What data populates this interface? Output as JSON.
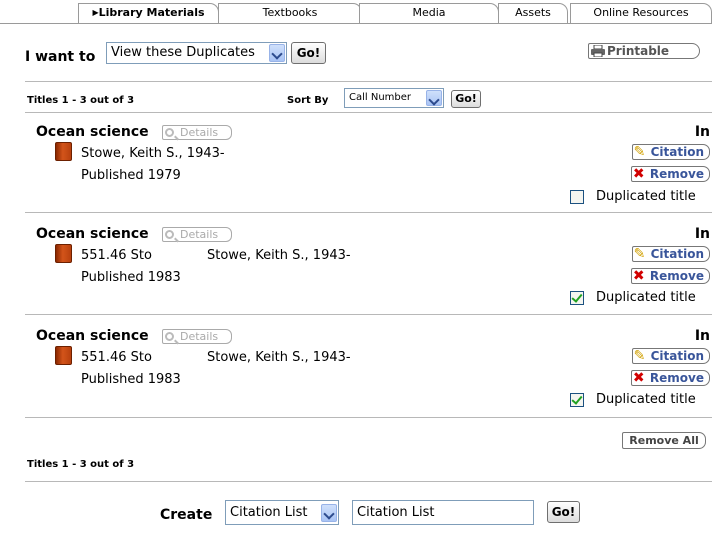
{
  "tabs": [
    {
      "label": "Library Materials",
      "active": true
    },
    {
      "label": "Textbooks",
      "active": false
    },
    {
      "label": "Media",
      "active": false
    },
    {
      "label": "Assets",
      "active": false
    },
    {
      "label": "Online Resources",
      "active": false
    }
  ],
  "action_bar": {
    "label": "I want to",
    "select_value": "View these Duplicates",
    "go_label": "Go!",
    "printable_label": "Printable"
  },
  "results_header": {
    "count_text": "Titles 1 - 3 out of 3",
    "sort_label": "Sort By",
    "sort_value": "Call Number",
    "go_label": "Go!"
  },
  "records": [
    {
      "title": "Ocean science",
      "details_label": "Details",
      "call_number": "",
      "author": "Stowe, Keith S., 1943-",
      "published": "Published 1979",
      "status": "In",
      "citation_label": "Citation",
      "remove_label": "Remove",
      "duplicated_checked": false,
      "duplicated_label": "Duplicated title"
    },
    {
      "title": "Ocean science",
      "details_label": "Details",
      "call_number": "551.46 Sto",
      "author": "Stowe, Keith S., 1943-",
      "published": "Published 1983",
      "status": "In",
      "citation_label": "Citation",
      "remove_label": "Remove",
      "duplicated_checked": true,
      "duplicated_label": "Duplicated title"
    },
    {
      "title": "Ocean science",
      "details_label": "Details",
      "call_number": "551.46 Sto",
      "author": "Stowe, Keith S., 1943-",
      "published": "Published 1983",
      "status": "In",
      "citation_label": "Citation",
      "remove_label": "Remove",
      "duplicated_checked": true,
      "duplicated_label": "Duplicated title"
    }
  ],
  "footer": {
    "remove_all_label": "Remove All",
    "count_text": "Titles 1 - 3 out of 3",
    "create_label": "Create",
    "create_select_value": "Citation List",
    "create_input_value": "Citation List",
    "go_label": "Go!"
  },
  "icons": {
    "book": "book-icon",
    "details": "magnifier-icon",
    "citation": "pencil-icon",
    "remove": "x-icon",
    "printable": "printer-icon"
  }
}
